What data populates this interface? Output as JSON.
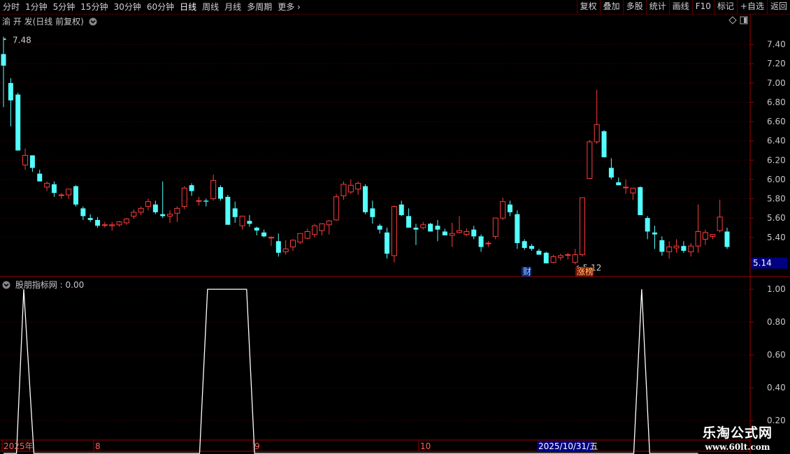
{
  "toolbar": {
    "left": [
      "分时",
      "1分钟",
      "5分钟",
      "15分钟",
      "30分钟",
      "60分钟",
      "日线",
      "周线",
      "月线",
      "多周期",
      "更多"
    ],
    "active": "日线",
    "right": [
      "复权",
      "叠加",
      "多股",
      "统计",
      "画线",
      "F10",
      "标记",
      "+自选",
      "返回"
    ]
  },
  "main_panel": {
    "title": "渝 开 发(日线 前复权)",
    "last_price_tag": "5.14",
    "high_label": "7.48",
    "low_label": "5.12",
    "event_tags": [
      "财",
      "涨榜"
    ]
  },
  "indicator_panel": {
    "title": "股朋指标网 : 0.00"
  },
  "time_axis": [
    "2025年",
    "8",
    "9",
    "10",
    "2025/10/31/五"
  ],
  "watermark": {
    "line1": "乐淘公式网",
    "line2": "www.60lt.com"
  },
  "colors": {
    "up": "#ff3c3c",
    "down": "#54ffff",
    "grid": "#5a0000",
    "axis": "#a00000",
    "line": "#ffffff",
    "tag_bg": "#000080"
  },
  "chart_data": [
    {
      "type": "candlestick",
      "ylim": [
        5.0,
        7.6
      ],
      "yticks": [
        5.4,
        5.6,
        5.8,
        6.0,
        6.2,
        6.4,
        6.6,
        6.8,
        7.0,
        7.2,
        7.4
      ],
      "ohlc": [
        [
          7.3,
          7.48,
          6.75,
          7.18
        ],
        [
          7.0,
          7.05,
          6.55,
          6.82
        ],
        [
          6.88,
          6.9,
          6.3,
          6.3
        ],
        [
          6.15,
          6.32,
          6.1,
          6.25
        ],
        [
          6.25,
          6.25,
          6.08,
          6.12
        ],
        [
          6.06,
          6.1,
          5.98,
          5.98
        ],
        [
          5.92,
          5.98,
          5.88,
          5.96
        ],
        [
          5.95,
          5.98,
          5.82,
          5.86
        ],
        [
          5.84,
          5.86,
          5.8,
          5.84
        ],
        [
          5.84,
          5.9,
          5.8,
          5.9
        ],
        [
          5.93,
          5.94,
          5.72,
          5.74
        ],
        [
          5.7,
          5.72,
          5.58,
          5.62
        ],
        [
          5.6,
          5.64,
          5.56,
          5.58
        ],
        [
          5.58,
          5.61,
          5.5,
          5.52
        ],
        [
          5.53,
          5.56,
          5.5,
          5.53
        ],
        [
          5.52,
          5.56,
          5.47,
          5.53
        ],
        [
          5.53,
          5.57,
          5.51,
          5.56
        ],
        [
          5.55,
          5.6,
          5.53,
          5.59
        ],
        [
          5.62,
          5.69,
          5.59,
          5.66
        ],
        [
          5.66,
          5.72,
          5.63,
          5.7
        ],
        [
          5.72,
          5.8,
          5.68,
          5.77
        ],
        [
          5.74,
          5.78,
          5.64,
          5.66
        ],
        [
          5.64,
          5.98,
          5.6,
          5.62
        ],
        [
          5.62,
          5.68,
          5.55,
          5.64
        ],
        [
          5.65,
          5.72,
          5.56,
          5.7
        ],
        [
          5.72,
          5.93,
          5.69,
          5.91
        ],
        [
          5.94,
          5.96,
          5.83,
          5.88
        ],
        [
          5.78,
          5.82,
          5.73,
          5.78
        ],
        [
          5.78,
          5.8,
          5.72,
          5.77
        ],
        [
          5.8,
          6.05,
          5.78,
          5.99
        ],
        [
          5.92,
          5.94,
          5.78,
          5.8
        ],
        [
          5.82,
          5.84,
          5.53,
          5.53
        ],
        [
          5.7,
          5.77,
          5.55,
          5.61
        ],
        [
          5.52,
          5.62,
          5.48,
          5.62
        ],
        [
          5.57,
          5.63,
          5.51,
          5.54
        ],
        [
          5.5,
          5.51,
          5.42,
          5.47
        ],
        [
          5.45,
          5.48,
          5.4,
          5.41
        ],
        [
          5.4,
          5.41,
          5.31,
          5.4
        ],
        [
          5.36,
          5.44,
          5.2,
          5.24
        ],
        [
          5.25,
          5.37,
          5.22,
          5.28
        ],
        [
          5.3,
          5.38,
          5.26,
          5.37
        ],
        [
          5.35,
          5.44,
          5.33,
          5.44
        ],
        [
          5.39,
          5.49,
          5.38,
          5.46
        ],
        [
          5.43,
          5.54,
          5.4,
          5.52
        ],
        [
          5.47,
          5.54,
          5.42,
          5.54
        ],
        [
          5.53,
          5.58,
          5.43,
          5.57
        ],
        [
          5.58,
          5.85,
          5.57,
          5.82
        ],
        [
          5.83,
          5.98,
          5.79,
          5.95
        ],
        [
          5.87,
          6.0,
          5.85,
          5.94
        ],
        [
          5.9,
          5.98,
          5.84,
          5.96
        ],
        [
          5.93,
          5.95,
          5.64,
          5.66
        ],
        [
          5.7,
          5.78,
          5.54,
          5.61
        ],
        [
          5.52,
          5.54,
          5.44,
          5.48
        ],
        [
          5.45,
          5.5,
          5.18,
          5.23
        ],
        [
          5.21,
          5.73,
          5.14,
          5.72
        ],
        [
          5.74,
          5.78,
          5.62,
          5.63
        ],
        [
          5.62,
          5.7,
          5.51,
          5.5
        ],
        [
          5.5,
          5.54,
          5.32,
          5.48
        ],
        [
          5.5,
          5.56,
          5.48,
          5.53
        ],
        [
          5.54,
          5.55,
          5.46,
          5.46
        ],
        [
          5.52,
          5.58,
          5.36,
          5.48
        ],
        [
          5.46,
          5.49,
          5.42,
          5.42
        ],
        [
          5.42,
          5.55,
          5.3,
          5.44
        ],
        [
          5.45,
          5.62,
          5.44,
          5.47
        ],
        [
          5.43,
          5.49,
          5.41,
          5.46
        ],
        [
          5.48,
          5.52,
          5.38,
          5.41
        ],
        [
          5.41,
          5.43,
          5.25,
          5.3
        ],
        [
          5.34,
          5.36,
          5.3,
          5.34
        ],
        [
          5.41,
          5.6,
          5.38,
          5.6
        ],
        [
          5.6,
          5.81,
          5.58,
          5.77
        ],
        [
          5.74,
          5.78,
          5.62,
          5.66
        ],
        [
          5.64,
          5.68,
          5.28,
          5.34
        ],
        [
          5.36,
          5.38,
          5.27,
          5.29
        ],
        [
          5.31,
          5.33,
          5.26,
          5.28
        ],
        [
          5.26,
          5.28,
          5.22,
          5.22
        ],
        [
          5.24,
          5.25,
          5.13,
          5.13
        ],
        [
          5.14,
          5.22,
          5.13,
          5.2
        ],
        [
          5.19,
          5.23,
          5.16,
          5.21
        ],
        [
          5.22,
          5.24,
          5.17,
          5.22
        ],
        [
          5.14,
          5.28,
          5.12,
          5.22
        ],
        [
          5.22,
          5.81,
          5.2,
          5.81
        ],
        [
          6.01,
          6.41,
          6.01,
          6.39
        ],
        [
          6.39,
          6.93,
          6.37,
          6.57
        ],
        [
          6.5,
          6.51,
          6.23,
          6.23
        ],
        [
          6.12,
          6.22,
          6.0,
          6.02
        ],
        [
          5.97,
          6.02,
          5.94,
          5.94
        ],
        [
          5.92,
          6.0,
          5.85,
          5.92
        ],
        [
          5.86,
          5.9,
          5.79,
          5.91
        ],
        [
          5.92,
          5.93,
          5.64,
          5.63
        ],
        [
          5.6,
          5.62,
          5.38,
          5.46
        ],
        [
          5.45,
          5.52,
          5.28,
          5.43
        ],
        [
          5.37,
          5.41,
          5.21,
          5.25
        ],
        [
          5.25,
          5.36,
          5.18,
          5.3
        ],
        [
          5.29,
          5.38,
          5.24,
          5.31
        ],
        [
          5.31,
          5.36,
          5.24,
          5.26
        ],
        [
          5.25,
          5.34,
          5.2,
          5.31
        ],
        [
          5.31,
          5.74,
          5.24,
          5.46
        ],
        [
          5.38,
          5.48,
          5.32,
          5.45
        ],
        [
          5.41,
          5.43,
          5.38,
          5.43
        ],
        [
          5.47,
          5.79,
          5.45,
          5.61
        ],
        [
          5.46,
          5.5,
          5.28,
          5.3
        ]
      ]
    },
    {
      "type": "line",
      "name": "股朋指标网",
      "ylim": [
        0.09,
        1.06
      ],
      "yticks": [
        0.2,
        0.4,
        0.6,
        0.8,
        1.0
      ],
      "x": [
        0,
        1.8,
        2.8,
        4.2,
        27.1,
        28.2,
        33.6,
        34.7,
        87.1,
        88.2,
        89.3,
        96
      ],
      "values": [
        0,
        0,
        1,
        0,
        0,
        1,
        1,
        0,
        0,
        1,
        0,
        0
      ]
    }
  ]
}
